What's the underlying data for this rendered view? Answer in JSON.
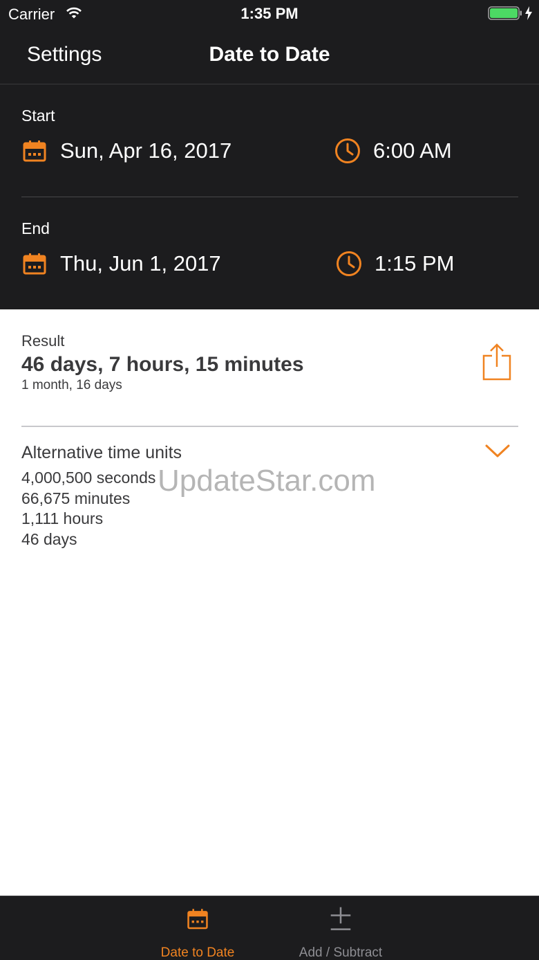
{
  "status_bar": {
    "carrier": "Carrier",
    "time": "1:35 PM"
  },
  "nav": {
    "settings_label": "Settings",
    "title": "Date to Date"
  },
  "start": {
    "label": "Start",
    "date": "Sun, Apr 16, 2017",
    "time": "6:00 AM"
  },
  "end": {
    "label": "End",
    "date": "Thu, Jun 1, 2017",
    "time": "1:15 PM"
  },
  "result": {
    "label": "Result",
    "value": "46 days, 7 hours, 15 minutes",
    "sub": "1 month, 16 days"
  },
  "alternative": {
    "title": "Alternative time units",
    "items": [
      "4,000,500 seconds",
      "66,675 minutes",
      "1,111 hours",
      "46 days"
    ]
  },
  "watermark": "UpdateStar.com",
  "tabs": [
    {
      "label": "Date to Date",
      "active": true,
      "icon": "calendar-icon"
    },
    {
      "label": "Add / Subtract",
      "active": false,
      "icon": "plus-minus-icon"
    }
  ],
  "colors": {
    "accent": "#F08321",
    "dark_bg": "#1C1C1E",
    "inactive_tab": "#8E8E93",
    "battery": "#4CD964"
  }
}
